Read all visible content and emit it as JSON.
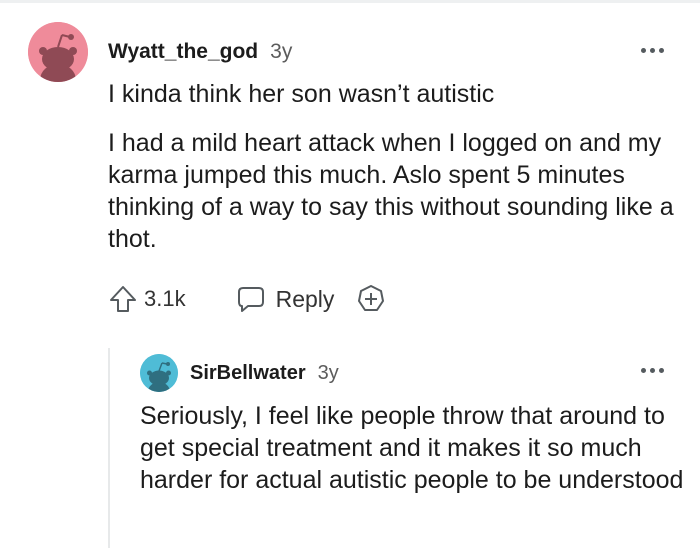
{
  "comment": {
    "username": "Wyatt_the_god",
    "timestamp": "3y",
    "paragraphs": [
      "I kinda think her son wasn’t autistic",
      "I had a mild heart attack when I logged on and my karma jumped this much. Aslo spent 5 minutes thinking of a way to say this without sounding like a thot."
    ],
    "votes": "3.1k",
    "reply_label": "Reply",
    "icons": {
      "upvote": "arrow-up-outline-icon",
      "reply": "speech-bubble-icon",
      "award": "plus-badge-icon",
      "more": "ellipsis-horizontal-icon"
    },
    "avatar_color": "#ef8b9a"
  },
  "reply": {
    "username": "SirBellwater",
    "timestamp": "3y",
    "text": "Seriously, I feel like people throw that around to get special treatment and it makes it so much harder for actual autistic people to be understood",
    "avatar_color": "#4fbcd6"
  }
}
